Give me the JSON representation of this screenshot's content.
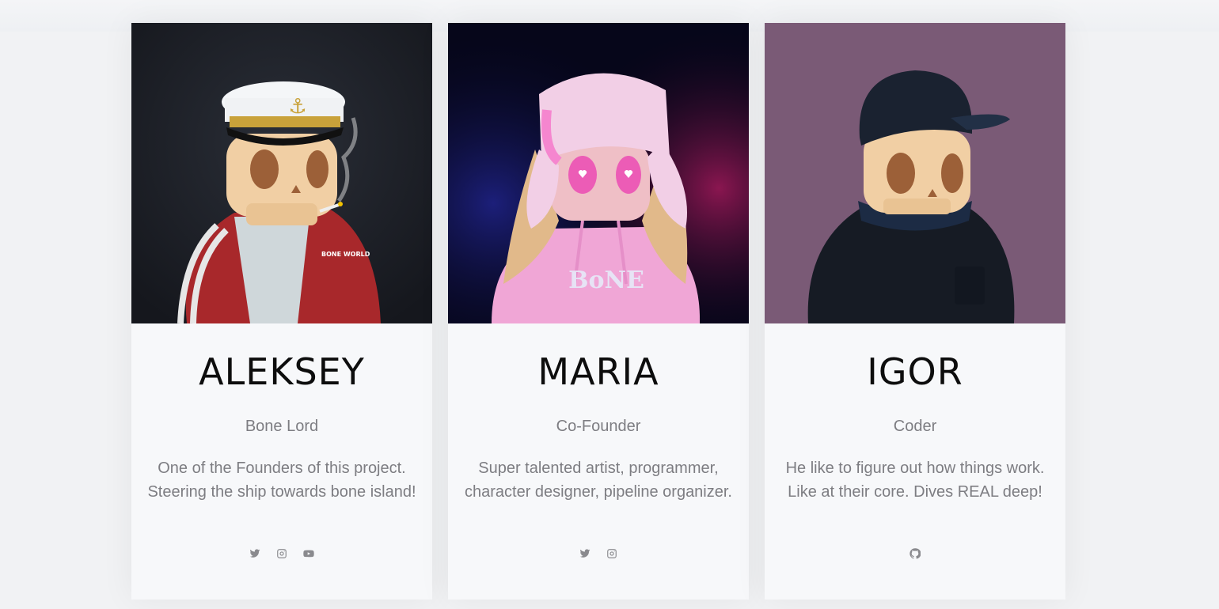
{
  "team": [
    {
      "name": "ALEKSEY",
      "role": "Bone Lord",
      "bio": "One of the Founders of this project. Steering the ship towards bone island!",
      "image_bg": "#1a1d24",
      "socials": [
        "twitter-icon",
        "instagram-icon",
        "youtube-icon"
      ]
    },
    {
      "name": "MARIA",
      "role": "Co-Founder",
      "bio": "Super talented artist, programmer, character designer, pipeline organizer.",
      "image_bg": "#0a0a22",
      "socials": [
        "twitter-icon",
        "instagram-icon"
      ]
    },
    {
      "name": "IGOR",
      "role": "Coder",
      "bio": "He like to figure out how things work. Like at their core. Dives REAL deep!",
      "image_bg": "#7a5a76",
      "socials": [
        "github-icon"
      ]
    }
  ],
  "artwork_text": {
    "jacket_print": "BONE WORLD",
    "hoodie_print": "BoNE"
  },
  "colors": {
    "page_bg": "#f1f2f4",
    "card_bg": "#f7f8fa",
    "name_text": "#0d0d0d",
    "muted_text": "#7d7d82",
    "icon": "#8a8a8e"
  }
}
